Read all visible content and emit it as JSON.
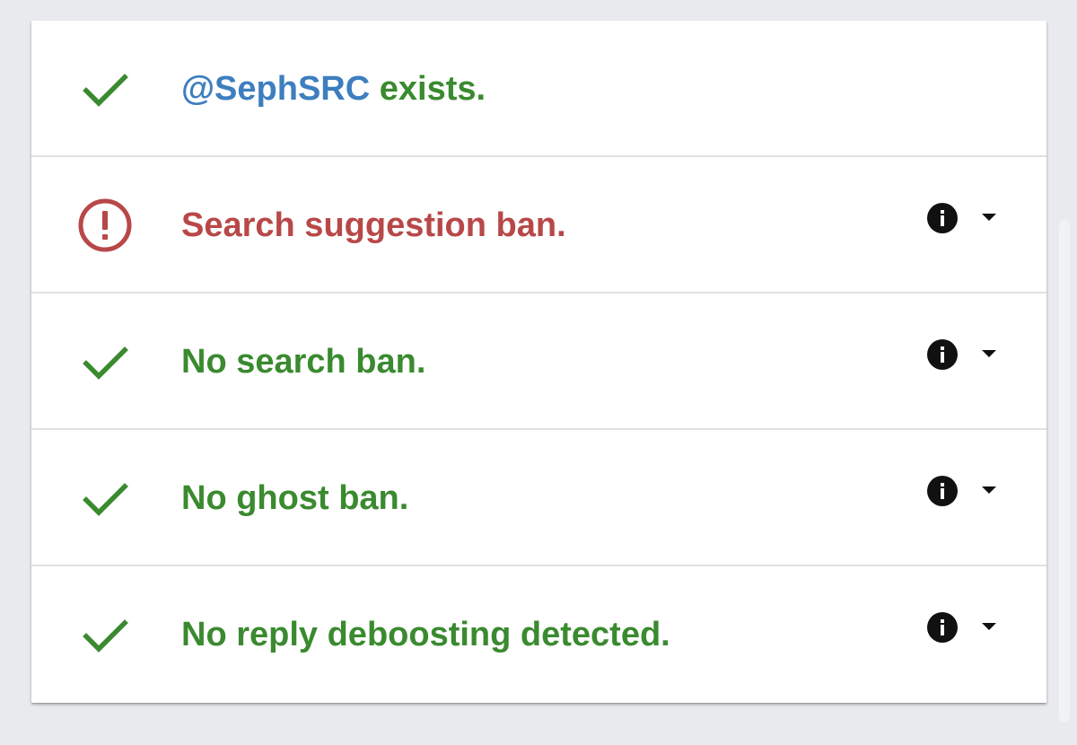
{
  "colors": {
    "success": "#3a8a2f",
    "error": "#b84848",
    "handle": "#3d7ebf",
    "info": "#111111"
  },
  "rows": [
    {
      "status": "ok",
      "icon": "checkmark-icon",
      "handle": "@SephSRC",
      "text": " exists.",
      "has_info": false
    },
    {
      "status": "error",
      "icon": "alert-circle-icon",
      "text": "Search suggestion ban.",
      "has_info": true
    },
    {
      "status": "ok",
      "icon": "checkmark-icon",
      "text": "No search ban.",
      "has_info": true
    },
    {
      "status": "ok",
      "icon": "checkmark-icon",
      "text": "No ghost ban.",
      "has_info": true
    },
    {
      "status": "ok",
      "icon": "checkmark-icon",
      "text": "No reply deboosting detected.",
      "has_info": true
    }
  ]
}
